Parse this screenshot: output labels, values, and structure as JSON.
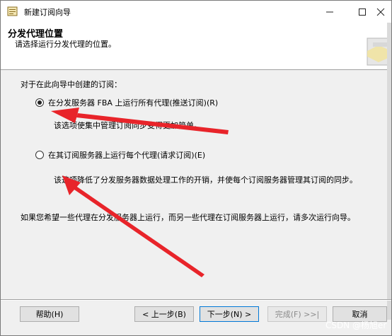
{
  "window": {
    "title": "新建订阅向导",
    "minimize_icon": "minimize-icon",
    "maximize_icon": "maximize-icon",
    "close_icon": "close-icon"
  },
  "header": {
    "title": "分发代理位置",
    "subtitle": "请选择运行分发代理的位置。"
  },
  "body": {
    "intro": "对于在此向导中创建的订阅：",
    "options": [
      {
        "label": "在分发服务器 FBA 上运行所有代理(推送订阅)(R)",
        "checked": true,
        "description": "该选项使集中管理订阅同步变得更加简单。"
      },
      {
        "label": "在其订阅服务器上运行每个代理(请求订阅)(E)",
        "checked": false,
        "description": "该选项降低了分发服务器数据处理工作的开销，并使每个订阅服务器管理其订阅的同步。"
      }
    ],
    "note": "如果您希望一些代理在分发服务器上运行，而另一些代理在订阅服务器上运行，请多次运行向导。"
  },
  "footer": {
    "help": "帮助(H)",
    "back": "< 上一步(B)",
    "next": "下一步(N) >",
    "finish": "完成(F) >>|",
    "cancel": "取消"
  },
  "annotation_color": "#e8242a",
  "watermark": "CSDN @杨旭er"
}
